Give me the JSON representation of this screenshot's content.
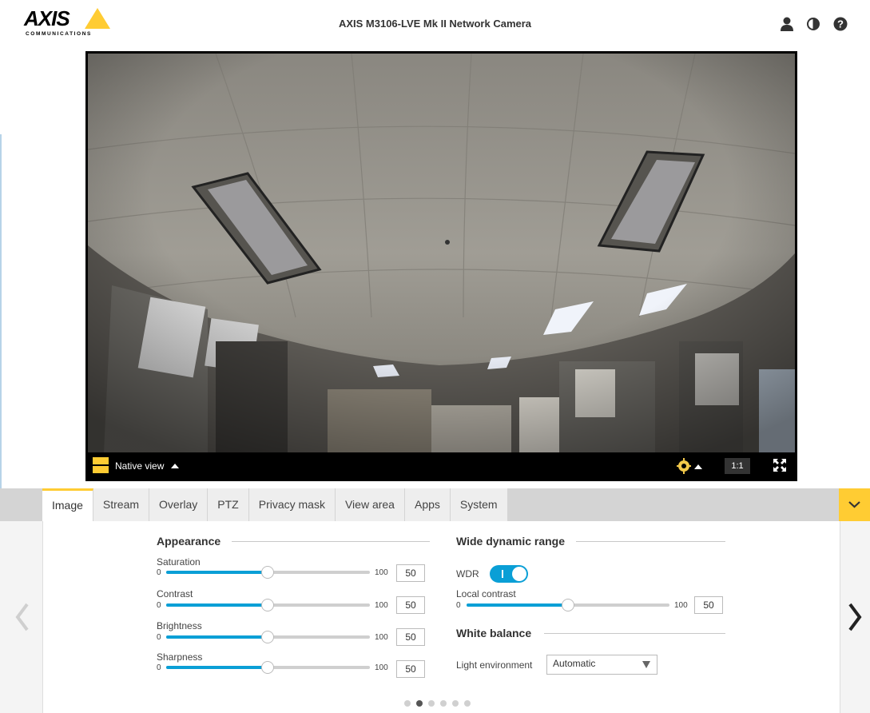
{
  "header": {
    "logo_text": "AXIS",
    "logo_sub": "COMMUNICATIONS",
    "title": "AXIS M3106-LVE Mk II Network Camera",
    "icons": [
      "user-icon",
      "contrast-icon",
      "help-icon"
    ]
  },
  "video": {
    "view_label": "Native view",
    "zoom_label": "1:1",
    "icons": [
      "view-mode-icon",
      "image-settings-icon",
      "fullscreen-icon"
    ]
  },
  "tabs": [
    {
      "label": "Image",
      "active": true
    },
    {
      "label": "Stream"
    },
    {
      "label": "Overlay"
    },
    {
      "label": "PTZ"
    },
    {
      "label": "Privacy mask"
    },
    {
      "label": "View area"
    },
    {
      "label": "Apps"
    },
    {
      "label": "System"
    }
  ],
  "appearance": {
    "title": "Appearance",
    "sliders": [
      {
        "label": "Saturation",
        "min": "0",
        "max": "100",
        "value": "50"
      },
      {
        "label": "Contrast",
        "min": "0",
        "max": "100",
        "value": "50"
      },
      {
        "label": "Brightness",
        "min": "0",
        "max": "100",
        "value": "50"
      },
      {
        "label": "Sharpness",
        "min": "0",
        "max": "100",
        "value": "50"
      }
    ]
  },
  "wdr": {
    "title": "Wide dynamic range",
    "toggle_label": "WDR",
    "toggle_on": true,
    "local_contrast": {
      "label": "Local contrast",
      "min": "0",
      "max": "100",
      "value": "50"
    }
  },
  "white_balance": {
    "title": "White balance",
    "light_env_label": "Light environment",
    "light_env_value": "Automatic"
  },
  "pagination": {
    "total": 6,
    "active_index": 1
  },
  "colors": {
    "accent": "#ffcc33",
    "slider": "#0a9fd6"
  }
}
